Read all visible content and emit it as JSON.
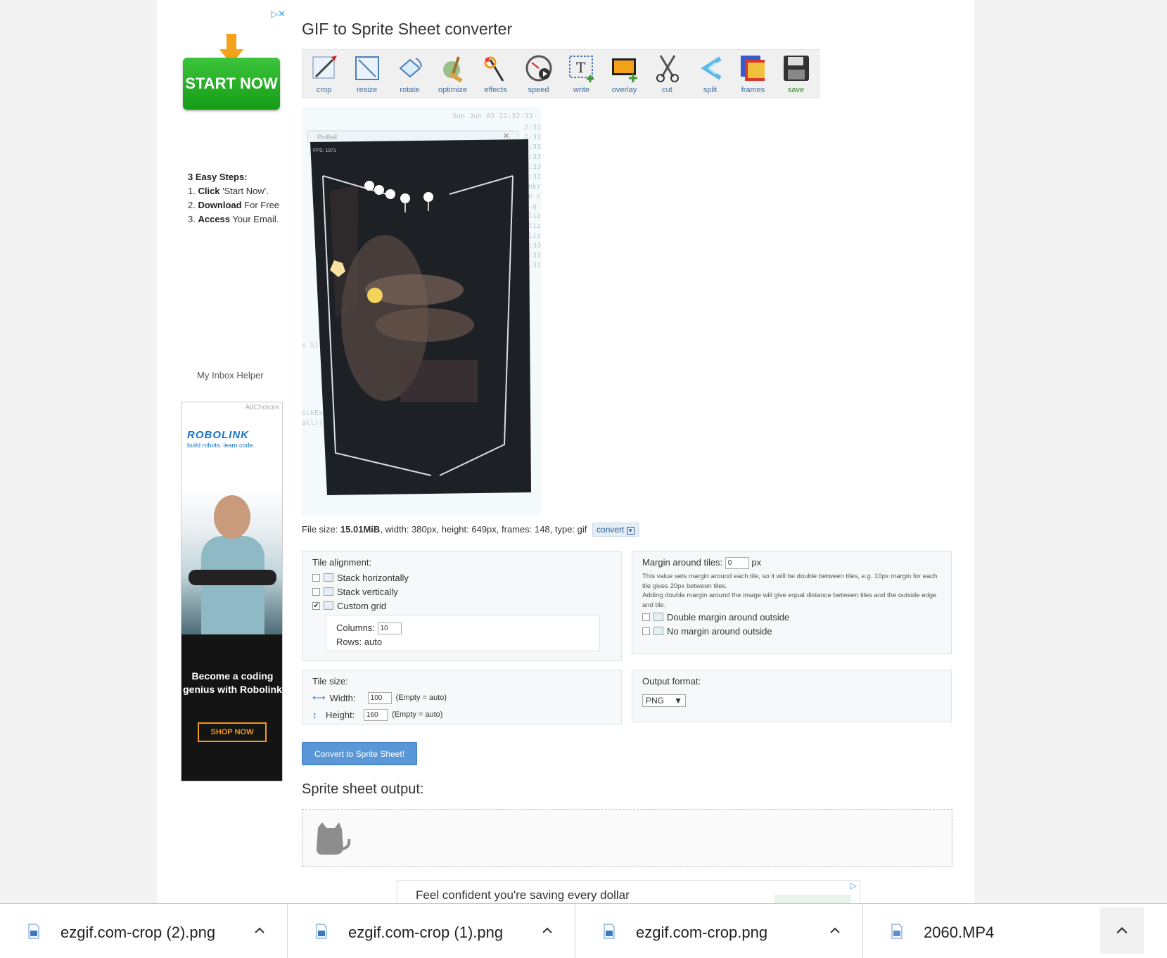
{
  "page": {
    "title": "GIF to Sprite Sheet converter"
  },
  "ad_top": {
    "start_label": "START NOW",
    "steps_heading": "3 Easy Steps:",
    "steps": [
      {
        "num": "1.",
        "bold": "Click",
        "rest": " 'Start Now'."
      },
      {
        "num": "2.",
        "bold": "Download",
        "rest": " For Free"
      },
      {
        "num": "3.",
        "bold": "Access",
        "rest": " Your Email."
      }
    ],
    "sponsor": "My Inbox Helper"
  },
  "ad_robolink": {
    "adchoices": "AdChoices",
    "logo": "ROBOLINK",
    "tagline": "build robots. learn code.",
    "headline": "Become a coding genius with Robolink",
    "cta": "SHOP NOW"
  },
  "toolbar": {
    "tools": [
      {
        "label": "crop",
        "icon": "crop-icon"
      },
      {
        "label": "resize",
        "icon": "resize-icon"
      },
      {
        "label": "rotate",
        "icon": "rotate-icon"
      },
      {
        "label": "optimize",
        "icon": "optimize-icon"
      },
      {
        "label": "effects",
        "icon": "effects-icon"
      },
      {
        "label": "speed",
        "icon": "speed-icon"
      },
      {
        "label": "write",
        "icon": "write-icon"
      },
      {
        "label": "overlay",
        "icon": "overlay-icon"
      },
      {
        "label": "cut",
        "icon": "cut-icon"
      },
      {
        "label": "split",
        "icon": "split-icon"
      },
      {
        "label": "frames",
        "icon": "frames-icon"
      },
      {
        "label": "save",
        "icon": "save-icon"
      }
    ]
  },
  "preview": {
    "window_title": "PinBall",
    "fps_text": "FPS: 1971",
    "console_date": "Sun Jun 02 22:32:33"
  },
  "file_info": {
    "size_label": "File size: ",
    "size_value": "15.01MiB",
    "details": ", width: 380px, height: 649px, frames: 148, type: gif",
    "convert_label": "convert"
  },
  "tile_alignment": {
    "heading": "Tile alignment:",
    "options": [
      {
        "label": "Stack horizontally",
        "checked": false
      },
      {
        "label": "Stack vertically",
        "checked": false
      },
      {
        "label": "Custom grid",
        "checked": true
      }
    ],
    "columns_label": "Columns:",
    "columns_value": "10",
    "rows_label": "Rows:",
    "rows_value": "auto"
  },
  "margin": {
    "label": "Margin around tiles:",
    "value": "0",
    "unit": "px",
    "note1": "This value sets margin around each tile, so it will be double between tiles, e.g. 10px margin for each tile gives 20px between tiles.",
    "note2": "Adding double margin around the image will give equal distance between tiles and the outside edge and tile.",
    "options": [
      {
        "label": "Double margin around outside",
        "checked": false
      },
      {
        "label": "No margin around outside",
        "checked": false
      }
    ]
  },
  "tile_size": {
    "heading": "Tile size:",
    "width_label": "Width:",
    "width_value": "100",
    "height_label": "Height:",
    "height_value": "160",
    "auto_hint": "(Empty = auto)"
  },
  "output_format": {
    "heading": "Output format:",
    "selected": "PNG"
  },
  "actions": {
    "convert_button": "Convert to Sprite Sheet!"
  },
  "output": {
    "title": "Sprite sheet output:"
  },
  "bottom_ad": {
    "text": "Feel confident you're saving every dollar"
  },
  "downloads": [
    {
      "name": "ezgif.com-crop (2).png"
    },
    {
      "name": "ezgif.com-crop (1).png"
    },
    {
      "name": "ezgif.com-crop.png"
    },
    {
      "name": "2060.MP4"
    }
  ],
  "colors": {
    "link": "#3a6ea5",
    "button": "#5a97d8",
    "start_green": "#1ea91e",
    "accent_orange": "#f39a1c"
  }
}
